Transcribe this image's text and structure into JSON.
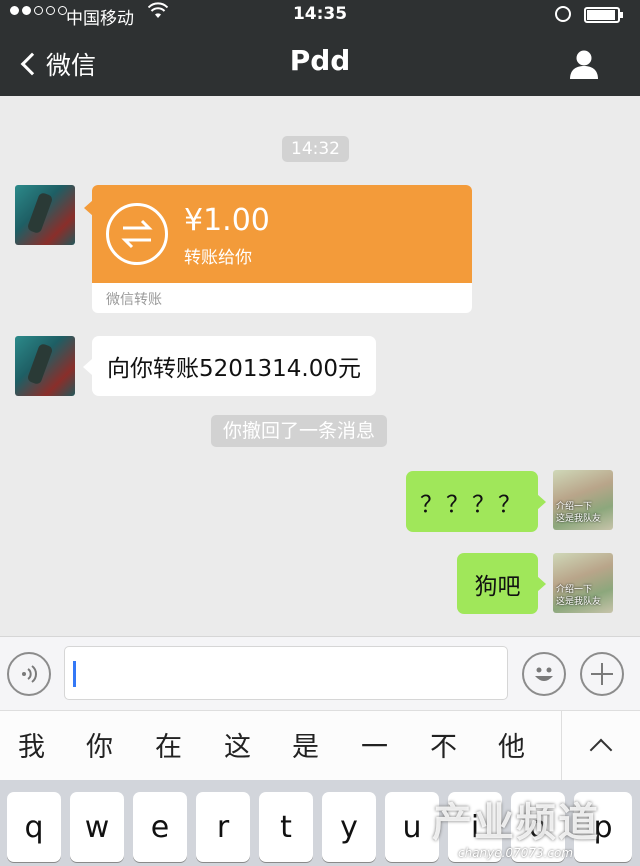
{
  "status_bar": {
    "carrier": "中国移动",
    "time": "14:35"
  },
  "nav": {
    "back_label": "微信",
    "title": "Pdd"
  },
  "chat": {
    "timestamp": "14:32",
    "transfer": {
      "currency_symbol": "¥",
      "amount": "¥1.00",
      "subtitle": "转账给你",
      "footer": "微信转账"
    },
    "msg_left_text": "向你转账5201314.00元",
    "system_notice": "你撤回了一条消息",
    "msg_right_1": "？？？？",
    "msg_right_2": "狗吧",
    "avatar_right_caption_1": "介绍一下",
    "avatar_right_caption_2": "这是我队友"
  },
  "input_bar": {
    "value": ""
  },
  "candidates": [
    "我",
    "你",
    "在",
    "这",
    "是",
    "一",
    "不",
    "他"
  ],
  "keyboard_row": [
    "q",
    "w",
    "e",
    "r",
    "t",
    "y",
    "u",
    "i",
    "o",
    "p"
  ],
  "watermark": {
    "title": "产业频道",
    "url": "chanye.07073.com"
  },
  "colors": {
    "nav_bg": "#2e3132",
    "chat_bg": "#ebebeb",
    "transfer_orange": "#f39b3a",
    "sent_bubble_green": "#a0e75a"
  }
}
